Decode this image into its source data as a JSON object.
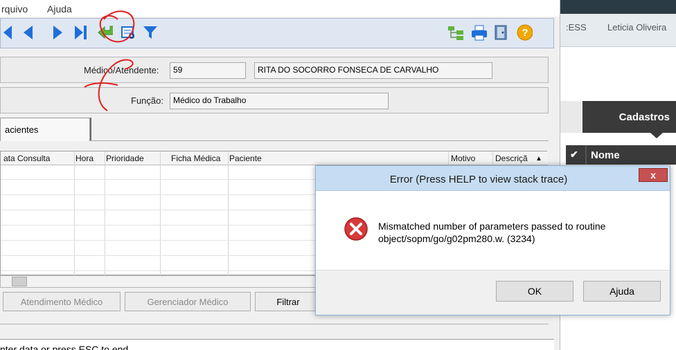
{
  "menu": {
    "arquivo": "rquivo",
    "ajuda": "Ajuda"
  },
  "toolbar": {
    "icons": [
      "first-icon",
      "previous-icon",
      "next-icon",
      "last-icon",
      "enter-icon",
      "preview-icon",
      "filter-icon",
      "tree-icon",
      "print-icon",
      "exit-door-icon",
      "help-icon"
    ],
    "colors": {
      "nav": "#1e6fd9",
      "enter": "#5fb53a",
      "help": "#f2a800"
    }
  },
  "form": {
    "medico_label": "Médico/Atendente:",
    "medico_code": "59",
    "medico_name": "RITA DO SOCORRO FONSECA DE CARVALHO",
    "funcao_label": "Função:",
    "funcao_value": "Médico do Trabalho"
  },
  "tab": {
    "label": "acientes"
  },
  "grid": {
    "columns": [
      "ata Consulta",
      "Hora",
      "Prioridade",
      "Ficha Médica",
      "Paciente",
      "Motivo",
      "Descriçã"
    ],
    "rows": []
  },
  "buttons": {
    "atendimento": "Atendimento Médico",
    "gerenciador": "Gerenciador Médico",
    "filtrar": "Filtrar"
  },
  "status": {
    "text": "nter data or press ESC to end"
  },
  "right": {
    "nav_partial": ":ESS",
    "user": "Leticia Oliveira",
    "cadastros": "Cadastros",
    "nome": "Nome"
  },
  "dialog": {
    "title": "Error (Press HELP to view stack trace)",
    "close": "x",
    "message_line1": "Mismatched number of parameters passed to routine",
    "message_line2": "object/sopm/go/g02pm280.w. (3234)",
    "ok": "OK",
    "help": "Ajuda"
  }
}
